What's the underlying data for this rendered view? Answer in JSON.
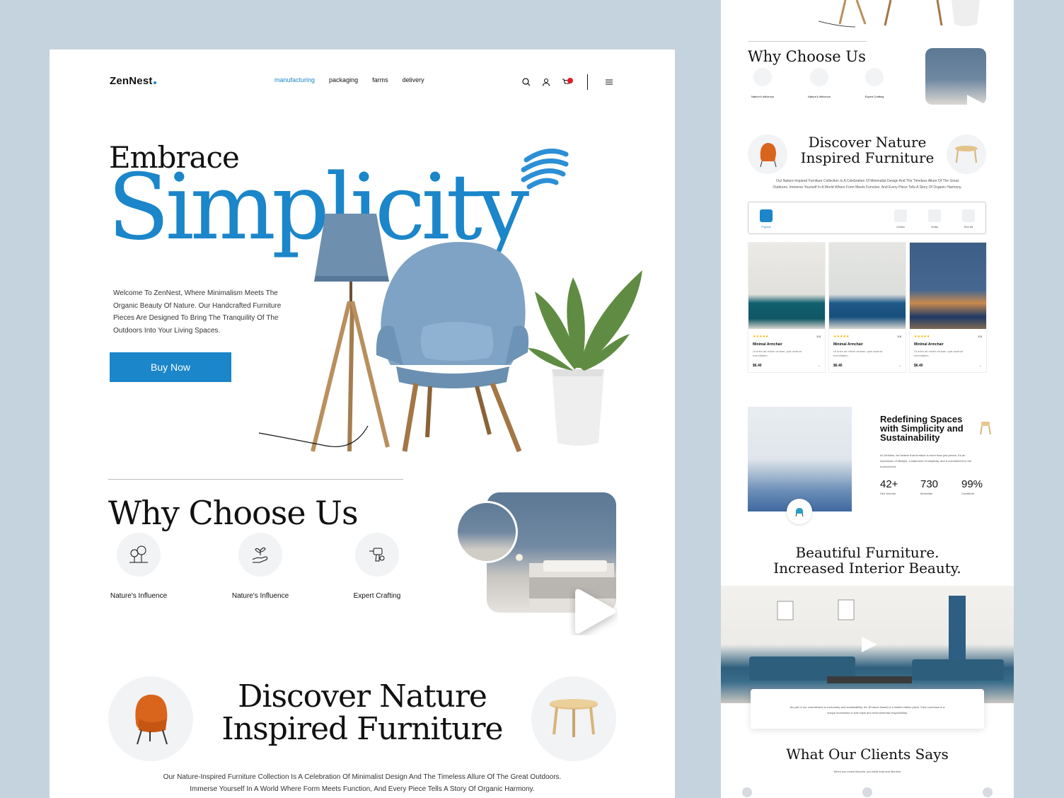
{
  "brand": {
    "name": "ZenNest",
    "accent": "#1b86c9"
  },
  "nav": {
    "links": [
      "manufacturing",
      "packaging",
      "farms",
      "delivery"
    ],
    "active": "manufacturing",
    "icons": [
      "search-icon",
      "user-icon",
      "cart-icon",
      "menu-icon"
    ]
  },
  "hero": {
    "line1": "Embrace",
    "line2": "Simplicity",
    "description": "Welcome To ZenNest, Where Minimalism Meets The Organic Beauty Of Nature. Our Handcrafted Furniture Pieces Are Designed To Bring The Tranquility Of The Outdoors Into Your Living Spaces.",
    "cta": "Buy Now"
  },
  "why": {
    "title": "Why Choose Us",
    "features": [
      {
        "label": "Nature's Influence",
        "icon": "trees-icon"
      },
      {
        "label": "Nature's Influence",
        "icon": "plant-hand-icon"
      },
      {
        "label": "Expert Crafting",
        "icon": "drill-icon"
      }
    ]
  },
  "discover": {
    "title_line1": "Discover Nature",
    "title_line2": "Inspired Furniture",
    "description": "Our Nature-Inspired Furniture Collection Is A Celebration Of Minimalist Design And The Timeless Allure Of The Great Outdoors. Immerse Yourself In A World Where Form Meets Function, And Every Piece Tells A Story Of Organic Harmony."
  },
  "right_page": {
    "why_title": "Why Choose Us",
    "why_features": [
      "Nature's Influence",
      "Nature's Influence",
      "Expert Crafting"
    ],
    "discover_line1": "Discover Nature",
    "discover_line2": "Inspired Furniture",
    "discover_desc": "Our Nature-Inspired Furniture Collection Is A Celebration Of Minimalist Design And The Timeless Allure Of The Great Outdoors. Immerse Yourself In A World Where Form Meets Function, And Every Piece Tells A Story Of Organic Harmony.",
    "tabs": [
      "Popular",
      "Chairs",
      "Sofas",
      "See All"
    ],
    "products": [
      {
        "name": "Minimal Armchair",
        "rating": "5.5",
        "desc": "Ut enim ad minim veniam, quis nostrud exercitation.",
        "price": "$6.40"
      },
      {
        "name": "Minimal Armchair",
        "rating": "5.6",
        "desc": "Ut enim ad minim veniam, quis nostrud exercitation.",
        "price": "$6.40"
      },
      {
        "name": "Minimal Armchair",
        "rating": "5.5",
        "desc": "Ut enim ad minim veniam, quis nostrud exercitation.",
        "price": "$6.40"
      }
    ],
    "redefining": {
      "title": "Redefining Spaces with Simplicity and Sustainability",
      "desc": "At ZenNest, we believe that furniture is more than just pieces; it's an expression of lifestyle, a statement of simplicity, and a commitment to the environment.",
      "stats": [
        {
          "value": "42+",
          "label": "Sed viuendo"
        },
        {
          "value": "730",
          "label": "Molestiae"
        },
        {
          "value": "99%",
          "label": "Constitute"
        }
      ]
    },
    "beautiful_line1": "Beautiful Furniture.",
    "beautiful_line2": "Increased Interior Beauty.",
    "note": "As part of our commitment to exclusivity and sustainability, the [Product Name] is a limited edition piece. Each purchase is a unique investment in both style and environmental responsibility.",
    "clients_title": "What Our Clients Says",
    "clients_sub": "When you invest Booorie, you build trust and Mcmeer"
  }
}
